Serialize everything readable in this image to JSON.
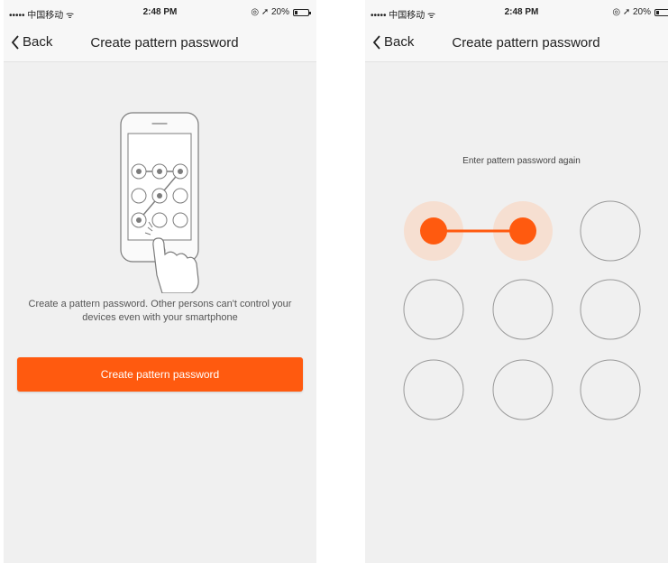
{
  "colors": {
    "accent": "#ff5a0f",
    "accent_halo": "#f7dccb",
    "screen_bg": "#f0f0f0",
    "nav_bg": "#f7f7f7"
  },
  "screen_left": {
    "status_bar": {
      "carrier": "••••• 中国移动 ᯤ",
      "time": "2:48 PM",
      "right": "◎ ➚ 20%",
      "battery_level": 0.2
    },
    "nav": {
      "back_label": "Back",
      "title": "Create pattern password",
      "back_icon": "chevron-left-icon"
    },
    "illustration": {
      "icon": "phone-pattern-hand-illustration",
      "dots_selected": [
        0,
        1,
        2,
        4,
        6
      ]
    },
    "description": "Create a pattern password. Other persons can't control your devices even with your smartphone",
    "button_label": "Create pattern password"
  },
  "screen_right": {
    "status_bar": {
      "carrier": "••••• 中国移动 ᯤ",
      "time": "2:48 PM",
      "right": "◎ ➚ 20%",
      "battery_level": 0.2
    },
    "nav": {
      "back_label": "Back",
      "title": "Create pattern password",
      "back_icon": "chevron-left-icon"
    },
    "prompt": "Enter pattern password again",
    "pattern": {
      "rows": 3,
      "cols": 3,
      "selected": [
        0,
        1
      ]
    }
  }
}
